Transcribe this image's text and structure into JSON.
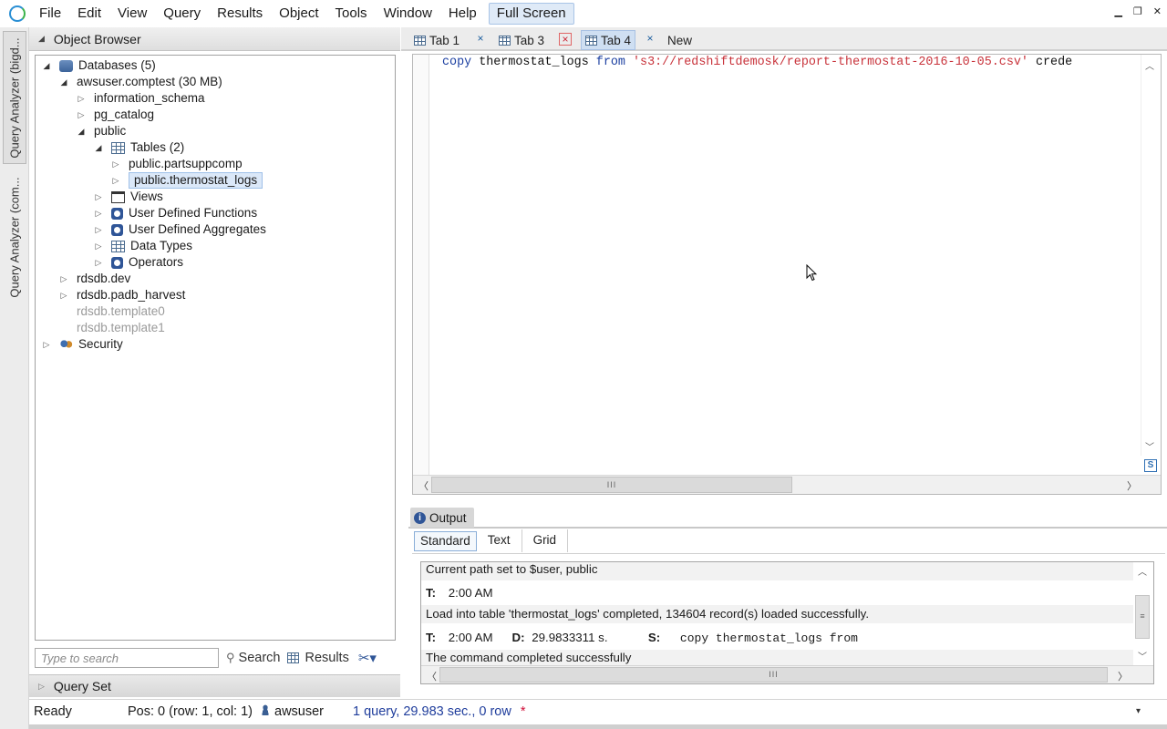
{
  "menubar": {
    "items": [
      "File",
      "Edit",
      "View",
      "Query",
      "Results",
      "Object",
      "Tools",
      "Window",
      "Help"
    ],
    "fullscreen_label": "Full Screen"
  },
  "side_tabs": [
    "Query Analyzer (bigd...",
    "Query Analyzer (com..."
  ],
  "object_browser": {
    "title": "Object Browser",
    "tree": [
      {
        "label": "Databases (5)",
        "icon": "database-icon"
      },
      {
        "label": "awsuser.comptest (30 MB)"
      },
      {
        "label": "information_schema"
      },
      {
        "label": "pg_catalog"
      },
      {
        "label": "public"
      },
      {
        "label": "Tables (2)",
        "icon": "table-icon"
      },
      {
        "label": "public.partsuppcomp"
      },
      {
        "label": "public.thermostat_logs"
      },
      {
        "label": "Views",
        "icon": "view-icon"
      },
      {
        "label": "User Defined Functions",
        "icon": "gear-icon"
      },
      {
        "label": "User Defined Aggregates",
        "icon": "gear-icon"
      },
      {
        "label": "Data Types",
        "icon": "table-icon"
      },
      {
        "label": "Operators",
        "icon": "gear-icon"
      },
      {
        "label": "rdsdb.dev"
      },
      {
        "label": "rdsdb.padb_harvest"
      },
      {
        "label": "rdsdb.template0"
      },
      {
        "label": "rdsdb.template1"
      },
      {
        "label": "Security",
        "icon": "users-icon"
      }
    ],
    "search_placeholder": "Type to search",
    "search_label": "Search",
    "results_label": "Results"
  },
  "query_set": {
    "label": "Query Set"
  },
  "tabs": [
    {
      "label": "Tab 1"
    },
    {
      "label": "Tab 3"
    },
    {
      "label": "Tab 4"
    },
    {
      "label": "New"
    }
  ],
  "editor": {
    "tokens": {
      "kw1": "copy",
      "t1": "thermostat_logs",
      "kw2": "from",
      "str1": "'s3://redshiftdemosk/report-thermostat-2016-10-05.csv'",
      "t2": "crede"
    },
    "badge": "S"
  },
  "output": {
    "title": "Output",
    "subtabs": [
      "Standard",
      "Text",
      "Grid"
    ],
    "lines": {
      "path": "Current path set to $user, public",
      "t_label": "T:",
      "time1": "2:00 AM",
      "load": "Load into table 'thermostat_logs' completed, 134604 record(s) loaded successfully.",
      "time2": "2:00 AM",
      "d_label": "D:",
      "duration": "29.9833311 s.",
      "s_label": "S:",
      "statement": "copy thermostat_logs from",
      "done": "The command completed successfully"
    }
  },
  "statusbar": {
    "ready": "Ready",
    "pos": "Pos: 0 (row: 1, col: 1)",
    "user": "awsuser",
    "summary": "1 query, 29.983 sec., 0 row",
    "modified": "*"
  },
  "colors": {
    "keyword": "#1a3ea0",
    "string": "#c8323a",
    "status_link": "#1f3d9c",
    "accent": "#2f5597"
  }
}
